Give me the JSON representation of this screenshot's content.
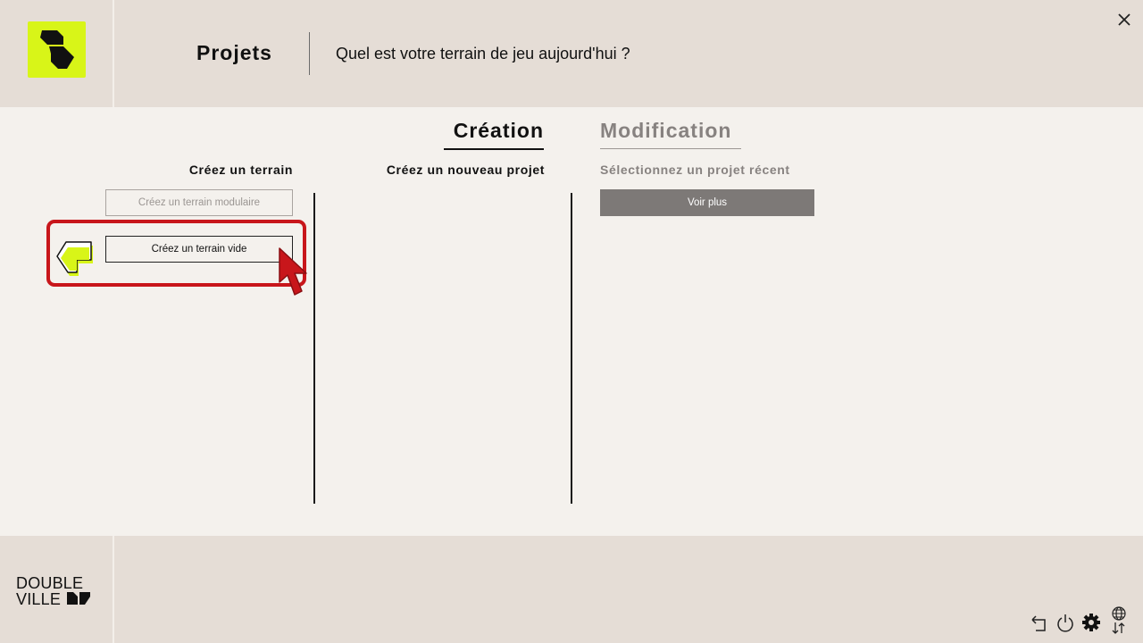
{
  "header": {
    "title": "Projets",
    "subtitle": "Quel est votre terrain de jeu aujourd'hui ?"
  },
  "tabs": [
    {
      "label": "Création",
      "active": true
    },
    {
      "label": "Modification",
      "active": false
    }
  ],
  "columns": {
    "terrain": {
      "heading": "Créez un terrain",
      "buttons": [
        "Créez un terrain modulaire",
        "Créez un terrain vide"
      ]
    },
    "projet": {
      "heading": "Créez un nouveau projet"
    },
    "recent": {
      "heading": "Sélectionnez un projet récent",
      "more_button": "Voir plus"
    }
  },
  "footer": {
    "brand_line1": "DOUBLE",
    "brand_line2": "VILLE",
    "icons": [
      "back-icon",
      "power-icon",
      "gear-icon",
      "language-icon"
    ]
  },
  "colors": {
    "accent": "#d8f518",
    "highlight": "#c8161b",
    "panel": "#e5ddd6",
    "background": "#f4f1ed",
    "muted": "#878280"
  }
}
